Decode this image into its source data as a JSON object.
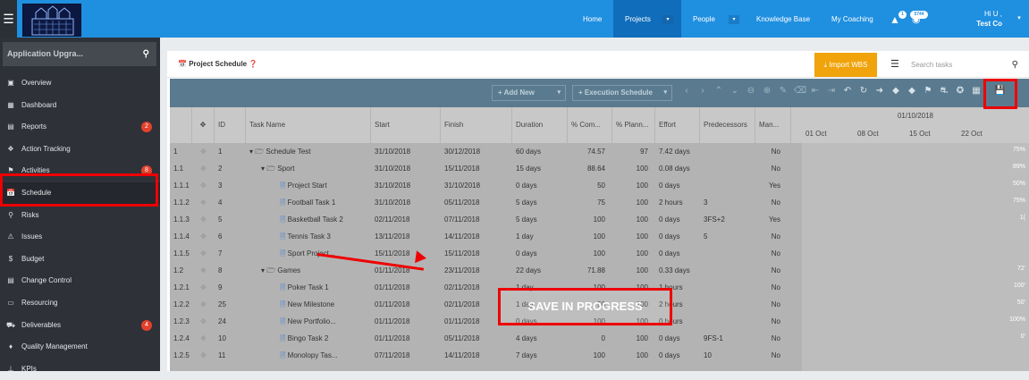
{
  "topbar": {
    "nav": [
      "Home",
      "Projects",
      "People",
      "Knowledge Base",
      "My Coaching"
    ],
    "alert_count": "1",
    "notif_count": "5744",
    "user_greeting": "Hi U ,",
    "user_company": "Test Co"
  },
  "sidebar": {
    "search_label": "Application Upgra...",
    "items": [
      {
        "label": "Overview",
        "icon": "overview-icon"
      },
      {
        "label": "Dashboard",
        "icon": "dashboard-icon"
      },
      {
        "label": "Reports",
        "icon": "reports-icon",
        "badge": "2"
      },
      {
        "label": "Action Tracking",
        "icon": "action-icon"
      },
      {
        "label": "Activities",
        "icon": "activities-icon",
        "badge": "8"
      },
      {
        "label": "Schedule",
        "icon": "calendar-icon"
      },
      {
        "label": "Risks",
        "icon": "risk-icon"
      },
      {
        "label": "Issues",
        "icon": "warning-icon"
      },
      {
        "label": "Budget",
        "icon": "dollar-icon"
      },
      {
        "label": "Change Control",
        "icon": "change-icon"
      },
      {
        "label": "Resourcing",
        "icon": "folder-icon"
      },
      {
        "label": "Deliverables",
        "icon": "deliverables-icon",
        "badge": "4"
      },
      {
        "label": "Quality Management",
        "icon": "tag-icon"
      },
      {
        "label": "KPIs",
        "icon": "kpi-icon"
      }
    ]
  },
  "main": {
    "title": "Project Schedule",
    "import_label": "Import WBS",
    "search_placeholder": "Search tasks",
    "toolbar": {
      "add_new": "+ Add New",
      "execution_schedule": "+ Execution Schedule"
    },
    "columns": [
      "ID",
      "Task Name",
      "Start",
      "Finish",
      "Duration",
      "% Com...",
      "% Plann...",
      "Effort",
      "Predecessors",
      "Man..."
    ],
    "gantt": {
      "date": "01/10/2018",
      "weeks": [
        "01 Oct",
        "08 Oct",
        "15 Oct",
        "22 Oct"
      ]
    },
    "rows": [
      {
        "wbs": "1",
        "id": "1",
        "name": "Schedule Test",
        "start": "31/10/2018",
        "finish": "30/12/2018",
        "duration": "60 days",
        "complete": "74.57",
        "planned": "97",
        "effort": "7.42 days",
        "pred": "",
        "man": "No",
        "gantt": "75%"
      },
      {
        "wbs": "1.1",
        "id": "2",
        "name": "Sport",
        "start": "31/10/2018",
        "finish": "15/11/2018",
        "duration": "15 days",
        "complete": "88.64",
        "planned": "100",
        "effort": "0.08 days",
        "pred": "",
        "man": "No",
        "gantt": "89%"
      },
      {
        "wbs": "1.1.1",
        "id": "3",
        "name": "Project Start",
        "start": "31/10/2018",
        "finish": "31/10/2018",
        "duration": "0 days",
        "complete": "50",
        "planned": "100",
        "effort": "0 days",
        "pred": "",
        "man": "Yes",
        "gantt": "50%"
      },
      {
        "wbs": "1.1.2",
        "id": "4",
        "name": "Football Task 1",
        "start": "31/10/2018",
        "finish": "05/11/2018",
        "duration": "5 days",
        "complete": "75",
        "planned": "100",
        "effort": "2 hours",
        "pred": "3",
        "man": "No",
        "gantt": "75%"
      },
      {
        "wbs": "1.1.3",
        "id": "5",
        "name": "Basketball Task 2",
        "start": "02/11/2018",
        "finish": "07/11/2018",
        "duration": "5 days",
        "complete": "100",
        "planned": "100",
        "effort": "0 days",
        "pred": "3FS+2",
        "man": "Yes",
        "gantt": "1("
      },
      {
        "wbs": "1.1.4",
        "id": "6",
        "name": "Tennis Task 3",
        "start": "13/11/2018",
        "finish": "14/11/2018",
        "duration": "1 day",
        "complete": "100",
        "planned": "100",
        "effort": "0 days",
        "pred": "5",
        "man": "No",
        "gantt": ""
      },
      {
        "wbs": "1.1.5",
        "id": "7",
        "name": "Sport Project...",
        "start": "15/11/2018",
        "finish": "15/11/2018",
        "duration": "0 days",
        "complete": "100",
        "planned": "100",
        "effort": "0 days",
        "pred": "",
        "man": "No",
        "gantt": ""
      },
      {
        "wbs": "1.2",
        "id": "8",
        "name": "Games",
        "start": "01/11/2018",
        "finish": "23/11/2018",
        "duration": "22 days",
        "complete": "71.88",
        "planned": "100",
        "effort": "0.33 days",
        "pred": "",
        "man": "No",
        "gantt": "72'"
      },
      {
        "wbs": "1.2.1",
        "id": "9",
        "name": "Poker Task 1",
        "start": "01/11/2018",
        "finish": "02/11/2018",
        "duration": "1 day",
        "complete": "100",
        "planned": "100",
        "effort": "1 hours",
        "pred": "",
        "man": "No",
        "gantt": "100'"
      },
      {
        "wbs": "1.2.2",
        "id": "25",
        "name": "New Milestone",
        "start": "01/11/2018",
        "finish": "02/11/2018",
        "duration": "1 day",
        "complete": "50",
        "planned": "100",
        "effort": "2 hours",
        "pred": "",
        "man": "No",
        "gantt": "50'"
      },
      {
        "wbs": "1.2.3",
        "id": "24",
        "name": "New Portfolio...",
        "start": "01/11/2018",
        "finish": "01/11/2018",
        "duration": "0 days",
        "complete": "100",
        "planned": "100",
        "effort": "0 hours",
        "pred": "",
        "man": "No",
        "gantt": "100%"
      },
      {
        "wbs": "1.2.4",
        "id": "10",
        "name": "Bingo Task 2",
        "start": "01/11/2018",
        "finish": "05/11/2018",
        "duration": "4 days",
        "complete": "0",
        "planned": "100",
        "effort": "0 days",
        "pred": "9FS-1",
        "man": "No",
        "gantt": "0'"
      },
      {
        "wbs": "1.2.5",
        "id": "11",
        "name": "Monolopy Tas...",
        "start": "07/11/2018",
        "finish": "14/11/2018",
        "duration": "7 days",
        "complete": "100",
        "planned": "100",
        "effort": "0 days",
        "pred": "10",
        "man": "No",
        "gantt": ""
      }
    ]
  },
  "overlay": {
    "save_text": "SAVE IN PROGRESS"
  },
  "colors": {
    "topbar": "#1f8fe0",
    "sidebar": "#2e3138",
    "highlight": "#ee0000",
    "import": "#f0a30a"
  }
}
